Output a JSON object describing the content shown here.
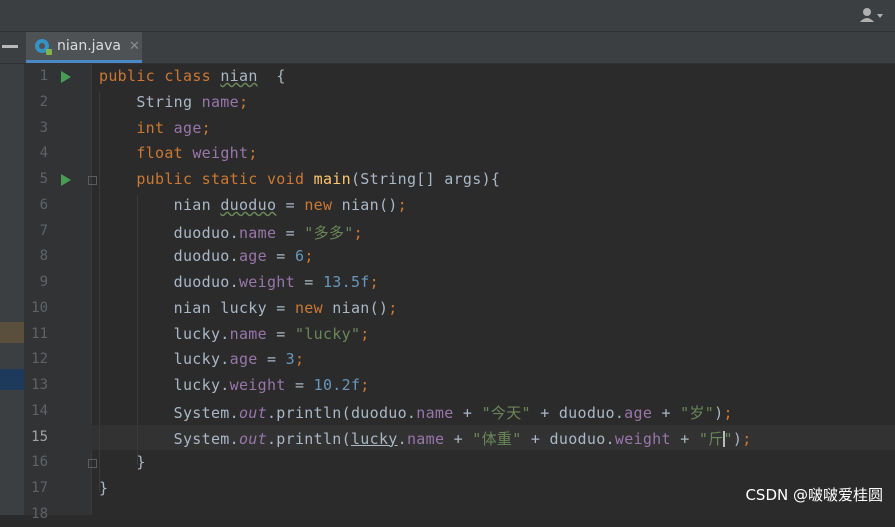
{
  "editor": {
    "tab_label": "nian.java",
    "tab_close": "✕",
    "current_line": 15
  },
  "lines": [
    {
      "n": "1",
      "tokens": [
        [
          "kw",
          "public "
        ],
        [
          "kw",
          "class "
        ],
        [
          "und",
          "nian"
        ],
        [
          "",
          "  {"
        ]
      ]
    },
    {
      "n": "2",
      "tokens": [
        [
          "",
          "    String "
        ],
        [
          "fld",
          "name"
        ],
        [
          "kw",
          ";"
        ]
      ]
    },
    {
      "n": "3",
      "tokens": [
        [
          "",
          "    "
        ],
        [
          "kw",
          "int "
        ],
        [
          "fld",
          "age"
        ],
        [
          "kw",
          ";"
        ]
      ]
    },
    {
      "n": "4",
      "tokens": [
        [
          "",
          "    "
        ],
        [
          "kw",
          "float "
        ],
        [
          "fld",
          "weight"
        ],
        [
          "kw",
          ";"
        ]
      ]
    },
    {
      "n": "5",
      "tokens": [
        [
          "",
          "    "
        ],
        [
          "kw",
          "public static void "
        ],
        [
          "fn",
          "main"
        ],
        [
          "",
          "(String[] args){"
        ]
      ]
    },
    {
      "n": "6",
      "tokens": [
        [
          "",
          "        nian "
        ],
        [
          "und",
          "duoduo"
        ],
        [
          "",
          " = "
        ],
        [
          "kw",
          "new "
        ],
        [
          "",
          "nian()"
        ],
        [
          "kw",
          ";"
        ]
      ]
    },
    {
      "n": "7",
      "tokens": [
        [
          "",
          "        duoduo."
        ],
        [
          "fld",
          "name"
        ],
        [
          "",
          " = "
        ],
        [
          "str",
          "\"多多\""
        ],
        [
          "kw",
          ";"
        ]
      ]
    },
    {
      "n": "8",
      "tokens": [
        [
          "",
          "        duoduo."
        ],
        [
          "fld",
          "age"
        ],
        [
          "",
          " = "
        ],
        [
          "num",
          "6"
        ],
        [
          "kw",
          ";"
        ]
      ]
    },
    {
      "n": "9",
      "tokens": [
        [
          "",
          "        duoduo."
        ],
        [
          "fld",
          "weight"
        ],
        [
          "",
          " = "
        ],
        [
          "num",
          "13.5f"
        ],
        [
          "kw",
          ";"
        ]
      ]
    },
    {
      "n": "10",
      "tokens": [
        [
          "",
          "        nian lucky = "
        ],
        [
          "kw",
          "new "
        ],
        [
          "",
          "nian()"
        ],
        [
          "kw",
          ";"
        ]
      ]
    },
    {
      "n": "11",
      "tokens": [
        [
          "",
          "        lucky."
        ],
        [
          "fld",
          "name"
        ],
        [
          "",
          " = "
        ],
        [
          "str",
          "\"lucky\""
        ],
        [
          "kw",
          ";"
        ]
      ]
    },
    {
      "n": "12",
      "tokens": [
        [
          "",
          "        lucky."
        ],
        [
          "fld",
          "age"
        ],
        [
          "",
          " = "
        ],
        [
          "num",
          "3"
        ],
        [
          "kw",
          ";"
        ]
      ]
    },
    {
      "n": "13",
      "tokens": [
        [
          "",
          "        lucky."
        ],
        [
          "fld",
          "weight"
        ],
        [
          "",
          " = "
        ],
        [
          "num",
          "10.2f"
        ],
        [
          "kw",
          ";"
        ]
      ]
    },
    {
      "n": "14",
      "tokens": [
        [
          "",
          "        System."
        ],
        [
          "st",
          "out"
        ],
        [
          "",
          ".println(duoduo."
        ],
        [
          "fld",
          "name"
        ],
        [
          "",
          " + "
        ],
        [
          "str",
          "\"今天\""
        ],
        [
          "",
          " + duoduo."
        ],
        [
          "fld",
          "age"
        ],
        [
          "",
          " + "
        ],
        [
          "str",
          "\"岁\""
        ],
        [
          "",
          ")"
        ],
        [
          "kw",
          ";"
        ]
      ]
    },
    {
      "n": "15",
      "tokens": [
        [
          "",
          "        System."
        ],
        [
          "st",
          "out"
        ],
        [
          "",
          ".println("
        ],
        [
          "lnk",
          "lucky"
        ],
        [
          "",
          "."
        ],
        [
          "fld",
          "name"
        ],
        [
          "",
          " + "
        ],
        [
          "str",
          "\"体重\""
        ],
        [
          "",
          " + duoduo."
        ],
        [
          "fld",
          "weight"
        ],
        [
          "",
          " + "
        ],
        [
          "str",
          "\"斤"
        ],
        [
          "caret",
          ""
        ],
        [
          "str",
          "\""
        ],
        [
          "",
          ")"
        ],
        [
          "kw",
          ";"
        ]
      ]
    },
    {
      "n": "16",
      "tokens": [
        [
          "",
          "    }"
        ]
      ]
    },
    {
      "n": "17",
      "tokens": [
        [
          "",
          "}"
        ]
      ]
    },
    {
      "n": "18",
      "tokens": []
    }
  ],
  "run_lines": [
    "1",
    "5"
  ],
  "fold_lines": [
    "5",
    "16"
  ],
  "watermark": "CSDN @啵啵爱桂圆",
  "colors": {
    "background": "#2b2b2b",
    "keyword": "#cc7832",
    "field": "#9876aa",
    "string": "#6a8759",
    "number": "#6897bb",
    "method": "#ffc66d"
  }
}
